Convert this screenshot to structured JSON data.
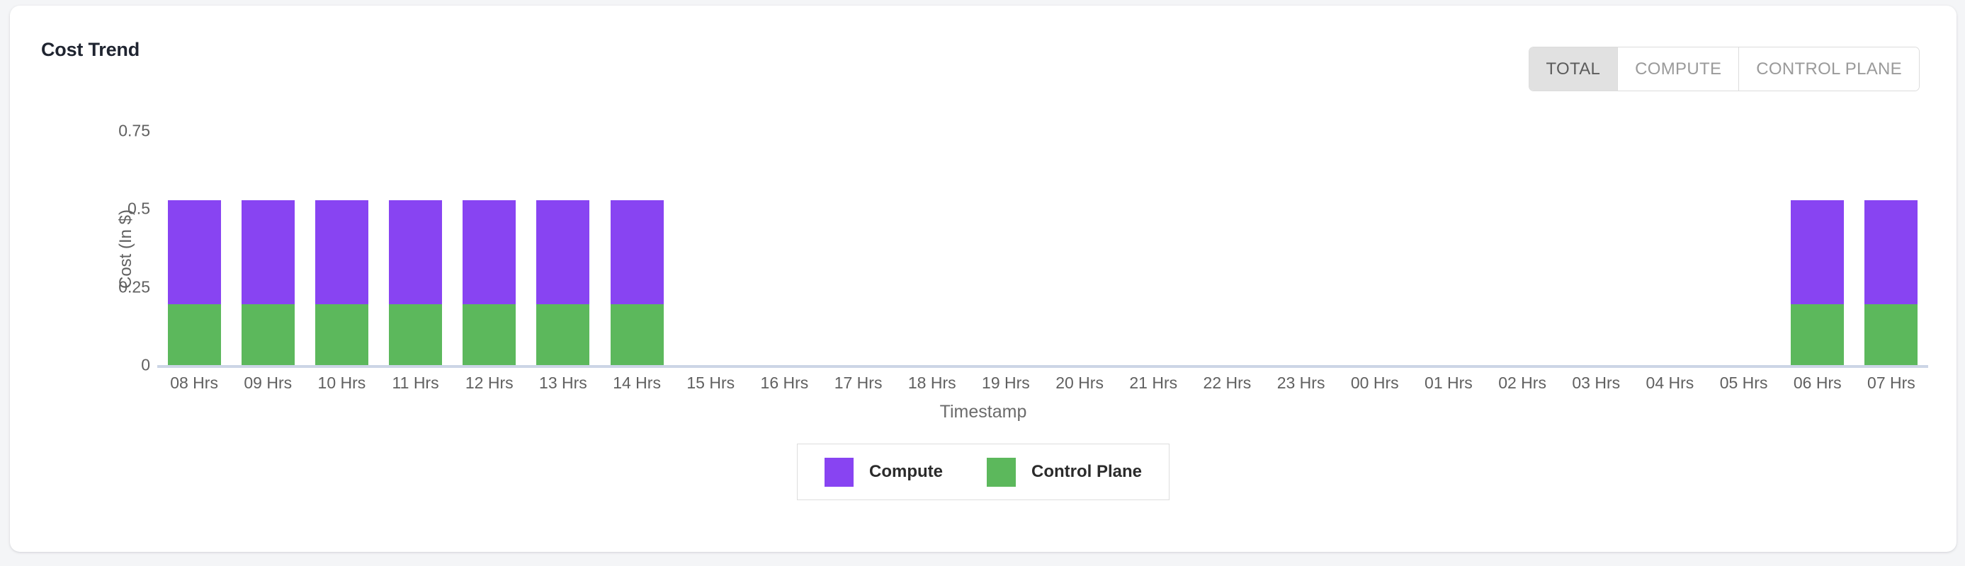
{
  "card": {
    "title": "Cost Trend"
  },
  "toggle": {
    "options": [
      {
        "label": "TOTAL",
        "active": true
      },
      {
        "label": "COMPUTE",
        "active": false
      },
      {
        "label": "CONTROL PLANE",
        "active": false
      }
    ],
    "selected": "TOTAL"
  },
  "legend": {
    "items": [
      {
        "label": "Compute",
        "color": "#8844f2"
      },
      {
        "label": "Control Plane",
        "color": "#5cb85c"
      }
    ]
  },
  "colors": {
    "compute": "#8844f2",
    "control_plane": "#5cb85c",
    "axis_line": "#ccd5e6",
    "tick_text": "#606060",
    "active_toggle_bg": "#e1e1e1",
    "card_bg": "#ffffff",
    "page_bg": "#f4f5f7"
  },
  "chart_data": {
    "type": "bar",
    "stacked": true,
    "title": "Cost Trend",
    "xlabel": "Timestamp",
    "ylabel": "Cost (In $)",
    "ylim": [
      0,
      0.8
    ],
    "yticks": [
      0,
      0.25,
      0.5,
      0.75
    ],
    "ytick_labels": [
      "0",
      "0.25",
      "0.5",
      "0.75"
    ],
    "grid": false,
    "legend_position": "bottom",
    "categories": [
      "08 Hrs",
      "09 Hrs",
      "10 Hrs",
      "11 Hrs",
      "12 Hrs",
      "13 Hrs",
      "14 Hrs",
      "15 Hrs",
      "16 Hrs",
      "17 Hrs",
      "18 Hrs",
      "19 Hrs",
      "20 Hrs",
      "21 Hrs",
      "22 Hrs",
      "23 Hrs",
      "00 Hrs",
      "01 Hrs",
      "02 Hrs",
      "03 Hrs",
      "04 Hrs",
      "05 Hrs",
      "06 Hrs",
      "07 Hrs"
    ],
    "series": [
      {
        "name": "Control Plane",
        "color": "#5cb85c",
        "values": [
          0.195,
          0.195,
          0.195,
          0.195,
          0.195,
          0.195,
          0.195,
          0,
          0,
          0,
          0,
          0,
          0,
          0,
          0,
          0,
          0,
          0,
          0,
          0,
          0,
          0,
          0.195,
          0.195
        ]
      },
      {
        "name": "Compute",
        "color": "#8844f2",
        "values": [
          0.332,
          0.332,
          0.332,
          0.332,
          0.332,
          0.332,
          0.332,
          0,
          0,
          0,
          0,
          0,
          0,
          0,
          0,
          0,
          0,
          0,
          0,
          0,
          0,
          0,
          0.332,
          0.332
        ]
      }
    ],
    "totals": [
      0.527,
      0.527,
      0.527,
      0.527,
      0.527,
      0.527,
      0.527,
      0,
      0,
      0,
      0,
      0,
      0,
      0,
      0,
      0,
      0,
      0,
      0,
      0,
      0,
      0,
      0.527,
      0.527
    ]
  }
}
